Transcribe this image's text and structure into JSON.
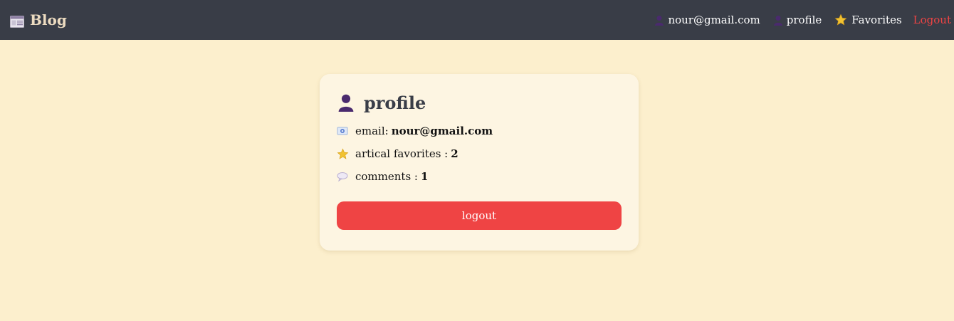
{
  "navbar": {
    "brand_label": "Blog",
    "brand_icon": "newspaper-icon",
    "user_email": "nour@gmail.com",
    "profile_label": "profile",
    "favorites_label": "Favorites",
    "logout_label": "Logout"
  },
  "profile_card": {
    "title": "profile",
    "title_icon": "user-icon",
    "email_label": "email:",
    "email_value": "nour@gmail.com",
    "favorites_label": "artical favorites :",
    "favorites_value": "2",
    "comments_label": "comments :",
    "comments_value": "1",
    "logout_button_label": "logout"
  },
  "colors": {
    "page_background": "#fcefcd",
    "navbar_background": "#393d47",
    "brand_color": "#eddcc1",
    "card_background": "#fdf5e2",
    "accent_red": "#ef4444",
    "user_icon_purple": "#4a2a6e",
    "star_yellow": "#f1c232"
  }
}
